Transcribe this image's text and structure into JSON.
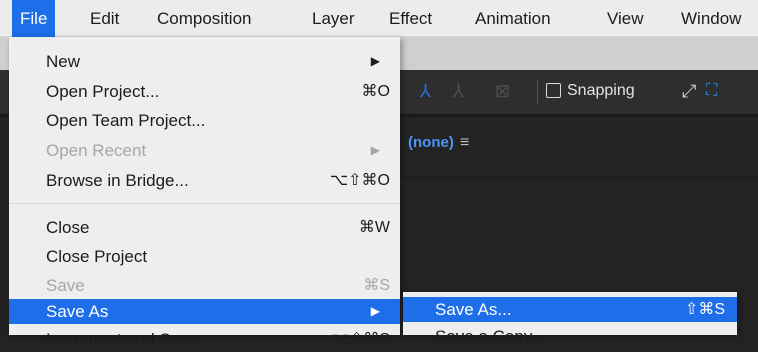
{
  "menubar": {
    "items": [
      "File",
      "Edit",
      "Composition",
      "Layer",
      "Effect",
      "Animation",
      "View",
      "Window"
    ]
  },
  "file_menu": {
    "items": [
      {
        "label": "New",
        "shortcut": "",
        "submenu": true,
        "disabled": false
      },
      {
        "label": "Open Project...",
        "shortcut": "⌘O",
        "submenu": false,
        "disabled": false
      },
      {
        "label": "Open Team Project...",
        "shortcut": "",
        "submenu": false,
        "disabled": false
      },
      {
        "label": "Open Recent",
        "shortcut": "",
        "submenu": true,
        "disabled": true
      },
      {
        "label": "Browse in Bridge...",
        "shortcut": "⌥⇧⌘O",
        "submenu": false,
        "disabled": false
      },
      {
        "label": "Close",
        "shortcut": "⌘W",
        "submenu": false,
        "disabled": false
      },
      {
        "label": "Close Project",
        "shortcut": "",
        "submenu": false,
        "disabled": false
      },
      {
        "label": "Save",
        "shortcut": "⌘S",
        "submenu": false,
        "disabled": true
      },
      {
        "label": "Save As",
        "shortcut": "",
        "submenu": true,
        "disabled": false,
        "highlighted": true
      },
      {
        "label": "Increment and Save",
        "shortcut": "⌥⇧⌘S",
        "submenu": false,
        "disabled": false,
        "partial": true
      }
    ],
    "arrow": "▶"
  },
  "save_as_submenu": {
    "items": [
      {
        "label": "Save As...",
        "shortcut": "⇧⌘S",
        "highlighted": true
      },
      {
        "label": "Save a Copy...",
        "shortcut": "",
        "partial": true
      }
    ]
  },
  "toolbar": {
    "snapping_label": "Snapping",
    "icons": [
      "axis-icon",
      "local-axis-icon",
      "view-axis-icon",
      "snap-icon",
      "expand-icon"
    ]
  },
  "panel": {
    "none_label": "(none)",
    "menu_glyph": "≡"
  },
  "colors": {
    "accent": "#1d6ee8",
    "menubar_bg": "#ececec",
    "app_dark": "#232323",
    "link_blue": "#4a96f5"
  }
}
